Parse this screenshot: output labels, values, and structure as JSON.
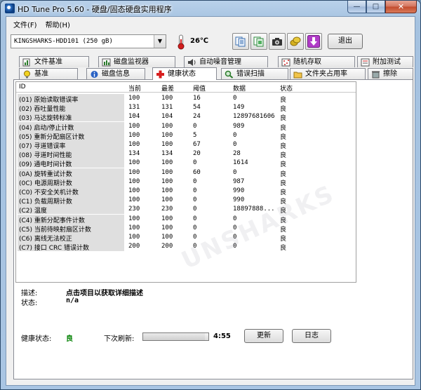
{
  "window": {
    "title": "HD Tune Pro 5.60 - 硬盘/固态硬盘实用程序",
    "minimize_glyph": "—",
    "maximize_glyph": "□",
    "close_glyph": "✕"
  },
  "menu": [
    "文件(F)",
    "帮助(H)"
  ],
  "toolbar": {
    "drive": "KINGSHARKS-HDD101 (250 gB)",
    "dropdown_glyph": "▼",
    "temperature": "26℃",
    "exit_label": "退出",
    "buttons": [
      "copy-text-icon",
      "copy-screenshot-icon",
      "camera-icon",
      "coins-icon",
      "download-icon"
    ],
    "colors": {
      "download": "#b13cc8",
      "coins": "#d4b020"
    }
  },
  "tabs_top": [
    "文件基准",
    "磁盘监视器",
    "自动噪音管理",
    "随机存取",
    "附加测试"
  ],
  "tabs_bottom": [
    "基准",
    "磁盘信息",
    "健康状态",
    "错误扫描",
    "文件夹占用率",
    "擦除"
  ],
  "active_tab": "健康状态",
  "table": {
    "headers": [
      "ID",
      "当前",
      "最差",
      "阈值",
      "数据",
      "状态"
    ],
    "rows": [
      [
        "(01) 原始读取错误率",
        "100",
        "100",
        "16",
        "0",
        "良"
      ],
      [
        "(02) 吞吐量性能",
        "131",
        "131",
        "54",
        "149",
        "良"
      ],
      [
        "(03) 马达旋转标准",
        "104",
        "104",
        "24",
        "12897681606",
        "良"
      ],
      [
        "(04) 启动/停止计数",
        "100",
        "100",
        "0",
        "989",
        "良"
      ],
      [
        "(05) 重新分配扇区计数",
        "100",
        "100",
        "5",
        "0",
        "良"
      ],
      [
        "(07) 寻道错误率",
        "100",
        "100",
        "67",
        "0",
        "良"
      ],
      [
        "(08) 寻道时间性能",
        "134",
        "134",
        "20",
        "28",
        "良"
      ],
      [
        "(09) 通电时间计数",
        "100",
        "100",
        "0",
        "1614",
        "良"
      ],
      [
        "(0A) 旋转重试计数",
        "100",
        "100",
        "60",
        "0",
        "良"
      ],
      [
        "(0C) 电源周期计数",
        "100",
        "100",
        "0",
        "987",
        "良"
      ],
      [
        "(C0) 不安全关机计数",
        "100",
        "100",
        "0",
        "990",
        "良"
      ],
      [
        "(C1) 负载周期计数",
        "100",
        "100",
        "0",
        "990",
        "良"
      ],
      [
        "(C2) 温度",
        "230",
        "230",
        "0",
        "18897888...",
        "良"
      ],
      [
        "(C4) 重新分配事件计数",
        "100",
        "100",
        "0",
        "0",
        "良"
      ],
      [
        "(C5) 当前待映射扇区计数",
        "100",
        "100",
        "0",
        "0",
        "良"
      ],
      [
        "(C6) 离线无法校正",
        "100",
        "100",
        "0",
        "0",
        "良"
      ],
      [
        "(C7) 接口 CRC 错误计数",
        "200",
        "200",
        "0",
        "0",
        "良"
      ]
    ]
  },
  "description": {
    "label": "描述:",
    "value": "点击项目以获取详细描述",
    "status_label": "状态:",
    "status_value": "n/a"
  },
  "health": {
    "label": "健康状态:",
    "value": "良",
    "value_color": "#008000",
    "refresh_label": "下次刷新:",
    "countdown": "4:55",
    "refresh_progress": 0.95
  },
  "buttons": {
    "update": "更新",
    "log": "日志"
  },
  "watermark": "UNSHARKS"
}
